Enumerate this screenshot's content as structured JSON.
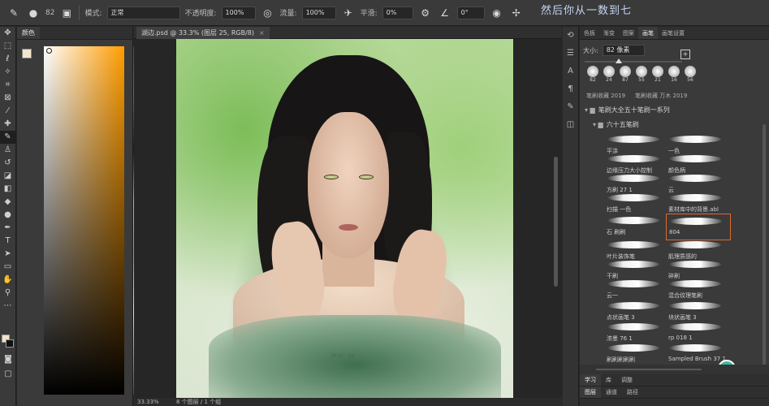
{
  "options_bar": {
    "brush_size": "82",
    "mode_label": "模式:",
    "mode_value": "正常",
    "opacity_label": "不透明度:",
    "opacity_value": "100%",
    "flow_label": "流量:",
    "flow_value": "100%",
    "smoothing_label": "平滑:",
    "smoothing_value": "0%",
    "angle_value": "0°"
  },
  "overlay_caption": "然后你从一数到七",
  "color_panel": {
    "tabs": [
      "颜色"
    ]
  },
  "document": {
    "tab_title": "湖边.psd @ 33.3% (图层 25, RGB/8)",
    "close_glyph": "×",
    "zoom": "33.33%",
    "status_info": "8 个图层 / 1 个组",
    "signature": "2019. 10"
  },
  "brush_panel": {
    "tabs": [
      "色板",
      "渐变",
      "图案",
      "画笔",
      "画笔设置"
    ],
    "active_tab": "画笔",
    "size_label": "大小:",
    "size_value": "82 像素",
    "recent": [
      {
        "size": "82"
      },
      {
        "size": "24"
      },
      {
        "size": "87"
      },
      {
        "size": "55"
      },
      {
        "size": "21"
      },
      {
        "size": "16"
      },
      {
        "size": "56"
      }
    ],
    "recent_group_names": [
      "笔刷收藏 2019",
      "笔刷收藏 万木 2019"
    ],
    "folder_1": "笔刷大全五十笔刷一系列",
    "folder_2": "六十五笔刷",
    "brushes": [
      {
        "name": "平涂"
      },
      {
        "name": "一色"
      },
      {
        "name": "边缘压力大小控制"
      },
      {
        "name": "颜色柄"
      },
      {
        "name": "方刷 27 1"
      },
      {
        "name": "云"
      },
      {
        "name": "扫描 一色"
      },
      {
        "name": "素材库中的背景.abl"
      },
      {
        "name": "石 刷刷"
      },
      {
        "name": "804"
      },
      {
        "name": "叶片装饰笔"
      },
      {
        "name": "肌理质感的"
      },
      {
        "name": "干刷"
      },
      {
        "name": "碎刷"
      },
      {
        "name": "云一"
      },
      {
        "name": "混合纹理笔刷"
      },
      {
        "name": "点状画笔 3"
      },
      {
        "name": "块状画笔 3"
      },
      {
        "name": "浓墨 76 1"
      },
      {
        "name": "rp 018 1"
      },
      {
        "name": "刷刷刷刷刷"
      },
      {
        "name": "Sampled Brush 37 1"
      }
    ],
    "selected_brush": "804",
    "lower_tabs_row1": [
      "学习",
      "库",
      "调整"
    ],
    "lower_tabs_row2": [
      "图层",
      "通道",
      "路径"
    ],
    "assistant_badge": "AI"
  },
  "colors": {
    "foreground": "#efe4c9",
    "background": "#111111",
    "selection_outline": "#d96a2e"
  }
}
